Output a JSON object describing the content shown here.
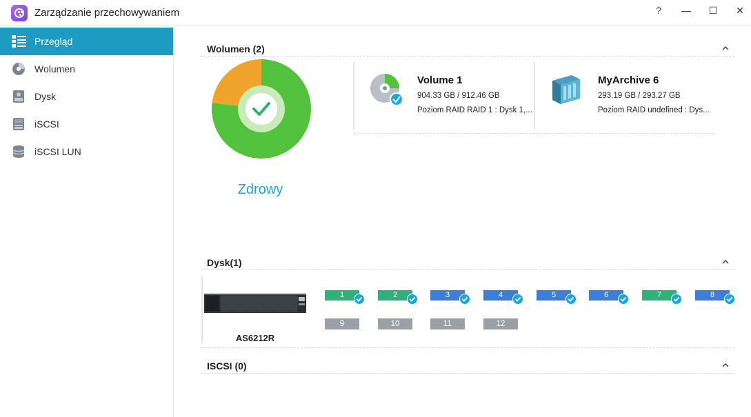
{
  "window": {
    "title": "Zarządzanie przechowywaniem",
    "help_glyph": "?",
    "minimize_glyph": "—",
    "maximize_glyph": "☐",
    "close_glyph": "✕"
  },
  "sidebar": {
    "items": [
      {
        "label": "Przegląd",
        "icon": "overview-icon",
        "active": true
      },
      {
        "label": "Wolumen",
        "icon": "volume-icon",
        "active": false
      },
      {
        "label": "Dysk",
        "icon": "disk-icon",
        "active": false
      },
      {
        "label": "iSCSI",
        "icon": "iscsi-icon",
        "active": false
      },
      {
        "label": "iSCSI LUN",
        "icon": "iscsi-lun-icon",
        "active": false
      }
    ]
  },
  "volumes_section": {
    "title": "Wolumen (2)",
    "health": {
      "status": "Zdrowy",
      "healthy_fraction": 0.77,
      "warning_fraction": 0.23,
      "colors": {
        "healthy": "#52c23d",
        "warning": "#f0a32a"
      }
    },
    "volumes": [
      {
        "name": "Volume 1",
        "size": "904.33 GB / 912.46 GB",
        "raid": "Poziom RAID RAID 1 : Dysk 1,...",
        "icon": "volume-disk-icon"
      },
      {
        "name": "MyArchive 6",
        "size": "293.19 GB / 293.27 GB",
        "raid": "Poziom RAID undefined : Dys...",
        "icon": "myarchive-icon"
      }
    ]
  },
  "disks_section": {
    "title": "Dysk(1)",
    "device": {
      "name": "AS6212R"
    },
    "bays": [
      {
        "label": "1",
        "color": "green",
        "checked": true
      },
      {
        "label": "2",
        "color": "green",
        "checked": true
      },
      {
        "label": "3",
        "color": "blue",
        "checked": true
      },
      {
        "label": "4",
        "color": "blue",
        "checked": true
      },
      {
        "label": "5",
        "color": "blue",
        "checked": true
      },
      {
        "label": "6",
        "color": "blue",
        "checked": true
      },
      {
        "label": "7",
        "color": "green",
        "checked": true
      },
      {
        "label": "8",
        "color": "blue",
        "checked": true
      },
      {
        "label": "9",
        "color": "gray",
        "checked": false
      },
      {
        "label": "10",
        "color": "gray",
        "checked": false
      },
      {
        "label": "11",
        "color": "gray",
        "checked": false
      },
      {
        "label": "12",
        "color": "gray",
        "checked": false
      }
    ]
  },
  "iscsi_section": {
    "title": "ISCSI (0)"
  }
}
